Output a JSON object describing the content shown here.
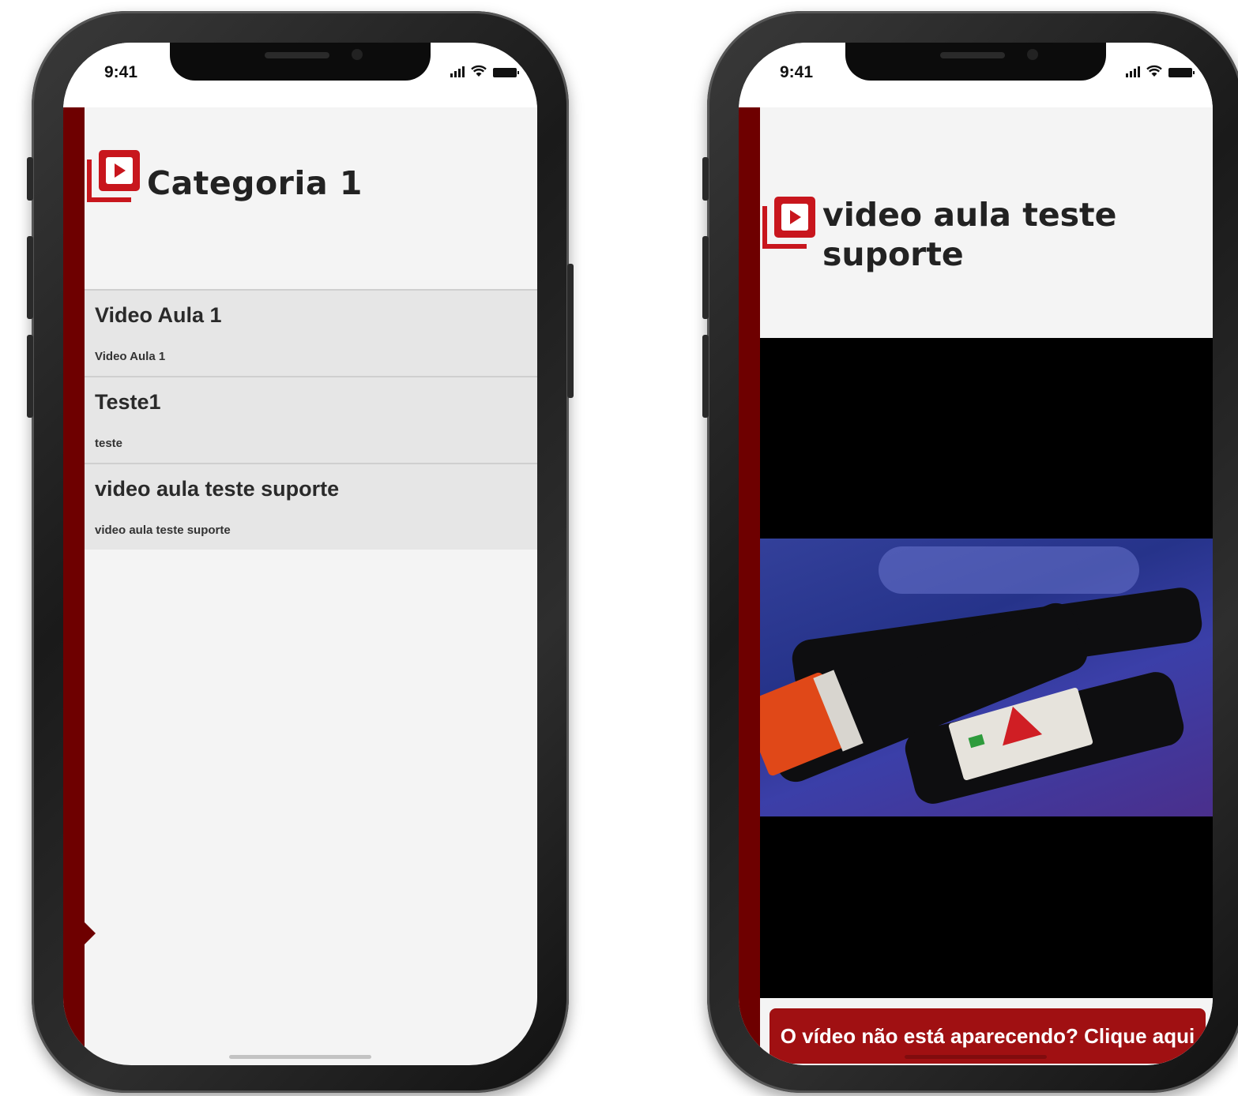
{
  "left_phone": {
    "status": {
      "time": "9:41"
    },
    "page_title": "Categoria 1",
    "video_list": [
      {
        "title": "Video Aula 1",
        "subtitle": "Video Aula 1"
      },
      {
        "title": "Teste1",
        "subtitle": "teste"
      },
      {
        "title": "video aula teste suporte",
        "subtitle": "video aula teste suporte"
      }
    ]
  },
  "right_phone": {
    "status": {
      "time": "9:41"
    },
    "page_title": "video aula teste suporte",
    "help_button_label": "O vídeo não está aparecendo? Clique aqui"
  },
  "colors": {
    "accent_dark_red": "#6e0000",
    "button_red": "#a01012",
    "logo_red": "#c8161d",
    "list_item_bg": "#e6e6e6",
    "screen_bg": "#f4f4f4"
  },
  "icons": [
    "video-category-icon",
    "play-icon",
    "signal-icon",
    "wifi-icon",
    "battery-icon"
  ]
}
